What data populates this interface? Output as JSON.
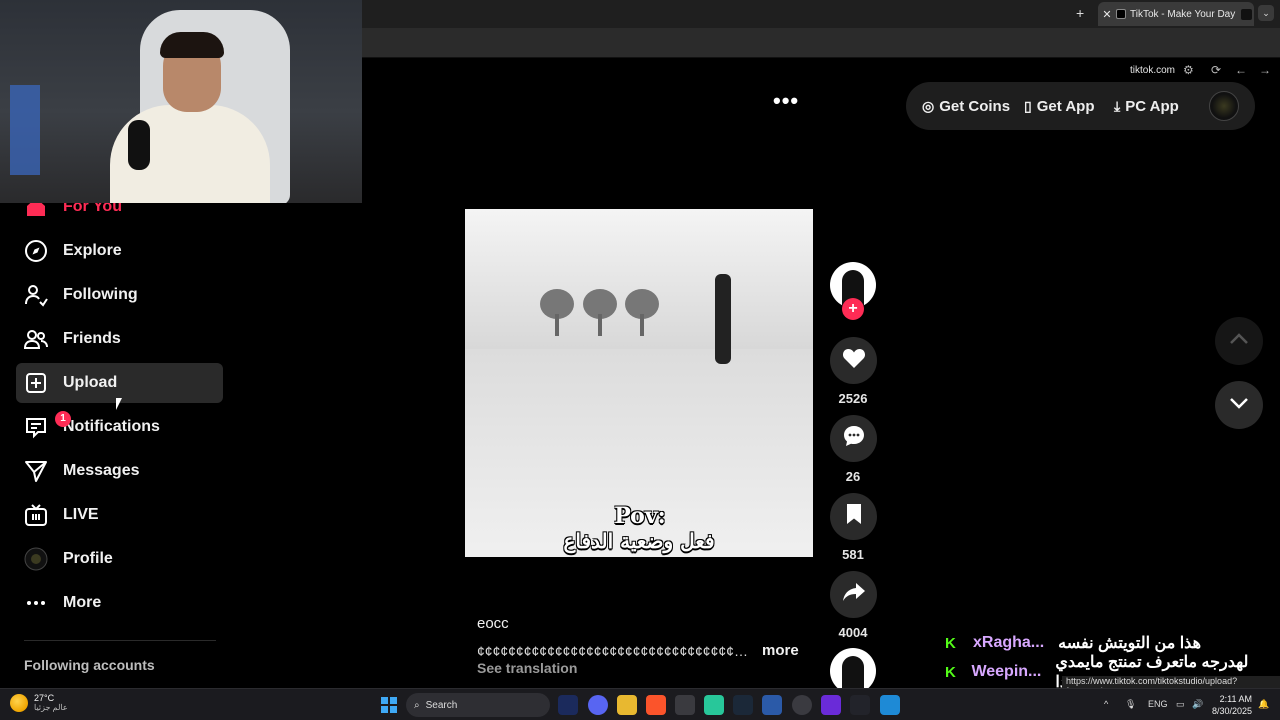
{
  "browser": {
    "tab_title": "TikTok - Make Your Day",
    "url": "tiktok.com",
    "new_tab": "+",
    "tab_close": "✕",
    "tab_menu": "⌄"
  },
  "sidebar": {
    "items": [
      {
        "label": "For You",
        "icon": "home-icon"
      },
      {
        "label": "Explore",
        "icon": "compass-icon"
      },
      {
        "label": "Following",
        "icon": "user-follow-icon"
      },
      {
        "label": "Friends",
        "icon": "friends-icon"
      },
      {
        "label": "Upload",
        "icon": "plus-square-icon"
      },
      {
        "label": "Notifications",
        "icon": "inbox-icon",
        "badge": "1"
      },
      {
        "label": "Messages",
        "icon": "paper-plane-icon"
      },
      {
        "label": "LIVE",
        "icon": "live-tv-icon"
      },
      {
        "label": "Profile",
        "icon": "avatar-icon"
      },
      {
        "label": "More",
        "icon": "ellipsis-icon"
      }
    ],
    "following_header": "Following accounts"
  },
  "topbar": {
    "get_coins": "Get Coins",
    "get_app": "Get App",
    "pc_app": "PC App"
  },
  "video": {
    "caption_line1": "Pov:",
    "caption_line2": "فعل وضعية الدفاع",
    "author": "eocc",
    "description": "¢¢¢¢¢¢¢¢¢¢¢¢¢¢¢¢¢¢¢¢¢¢¢¢¢¢¢¢¢¢¢¢¢¢¢¢¢¢¢¢¢¢¢¢¢¢¢¢¢¢¢¢¢¢¢¢¢¢¢¢¢¢¢¢¢¢¢¢¢¢¢¢¢¢...",
    "more": "more",
    "see_translation": "See translation"
  },
  "actions": {
    "likes": "2526",
    "comments": "26",
    "saves": "581",
    "shares": "4004",
    "follow_plus": "+"
  },
  "chat": [
    {
      "name": "xRagha...",
      "message": "هذا من التويتش نفسه"
    },
    {
      "name": "Weepin...",
      "message": "لهدرجه ماتعرف تمنتج مايمدي تسوي ذا"
    }
  ],
  "status_url": "https://www.tiktok.com/tiktokstudio/upload?from=webapp",
  "taskbar": {
    "temp": "27°C",
    "weather_desc": "عالم جزئيا",
    "search": "Search",
    "lang": "ENG",
    "time": "2:11 AM",
    "date": "8/30/2025"
  },
  "colors": {
    "accent": "#fe2c55",
    "kick_green": "#53fc18",
    "pill_bg": "#1e1e1e"
  }
}
